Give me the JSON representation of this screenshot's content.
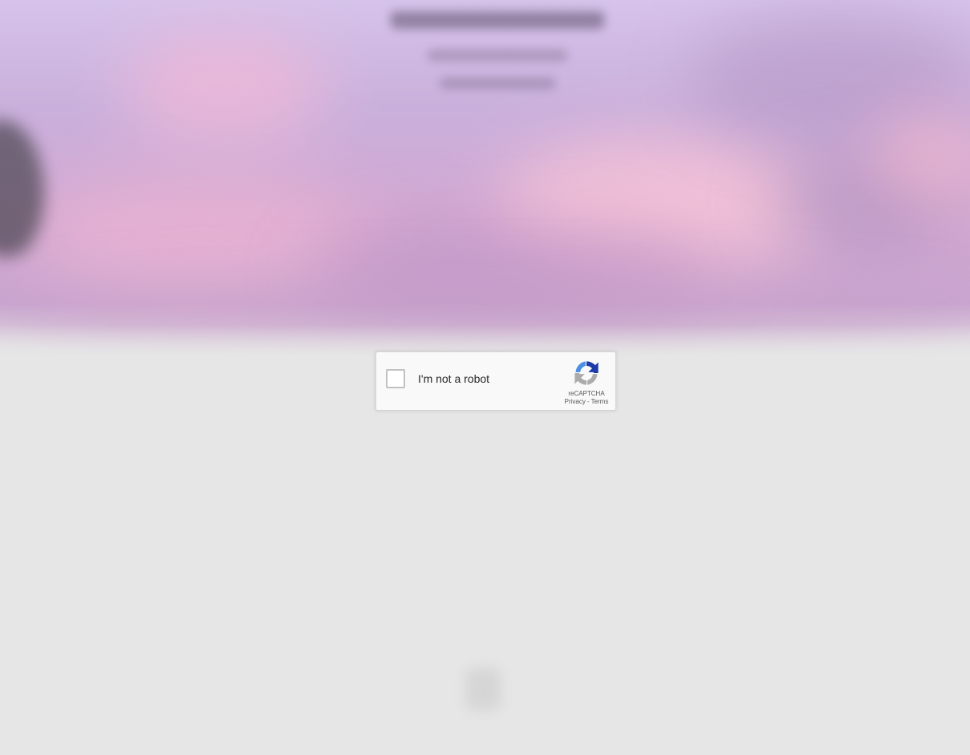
{
  "recaptcha": {
    "checkbox_label": "I'm not a robot",
    "brand": "reCAPTCHA",
    "privacy_link": "Privacy",
    "separator": "-",
    "terms_link": "Terms",
    "logo_icon": "recaptcha-logo-icon",
    "checked": false
  },
  "colors": {
    "page_background": "#e6e6e6",
    "widget_background": "#f9f9f9",
    "widget_border": "#d3d3d3",
    "logo_blue": "#1c3aa9",
    "logo_light_blue": "#4a90e2",
    "logo_gray": "#ababab"
  }
}
